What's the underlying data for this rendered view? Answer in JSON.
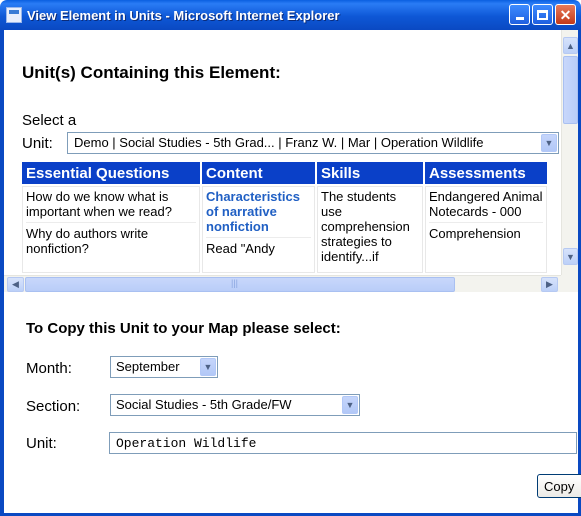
{
  "window": {
    "title": "View Element in Units - Microsoft Internet Explorer"
  },
  "upper": {
    "heading": "Unit(s) Containing this Element:",
    "select_label_line1": "Select a",
    "select_label_line2": "Unit:",
    "unit_select_value": "Demo | Social Studies - 5th Grad... | Franz W. | Mar | Operation Wildlife",
    "table": {
      "headers": [
        "Essential Questions",
        "Content",
        "Skills",
        "Assessments"
      ],
      "essential_questions": [
        "How do we know what is important when we read?",
        "Why do authors write nonfiction?"
      ],
      "content": [
        "Characteristics of narrative nonfiction",
        "Read \"Andy"
      ],
      "skills": [
        "The students use comprehension strategies to identify...if"
      ],
      "assessments": [
        "Endangered Animal Notecards - 000",
        "Comprehension"
      ]
    }
  },
  "form": {
    "heading": "To Copy this Unit to your Map please select:",
    "month_label": "Month:",
    "month_value": "September",
    "section_label": "Section:",
    "section_value": "Social Studies - 5th Grade/FW",
    "unit_label": "Unit:",
    "unit_value": "Operation Wildlife",
    "copy_button": "Copy"
  }
}
